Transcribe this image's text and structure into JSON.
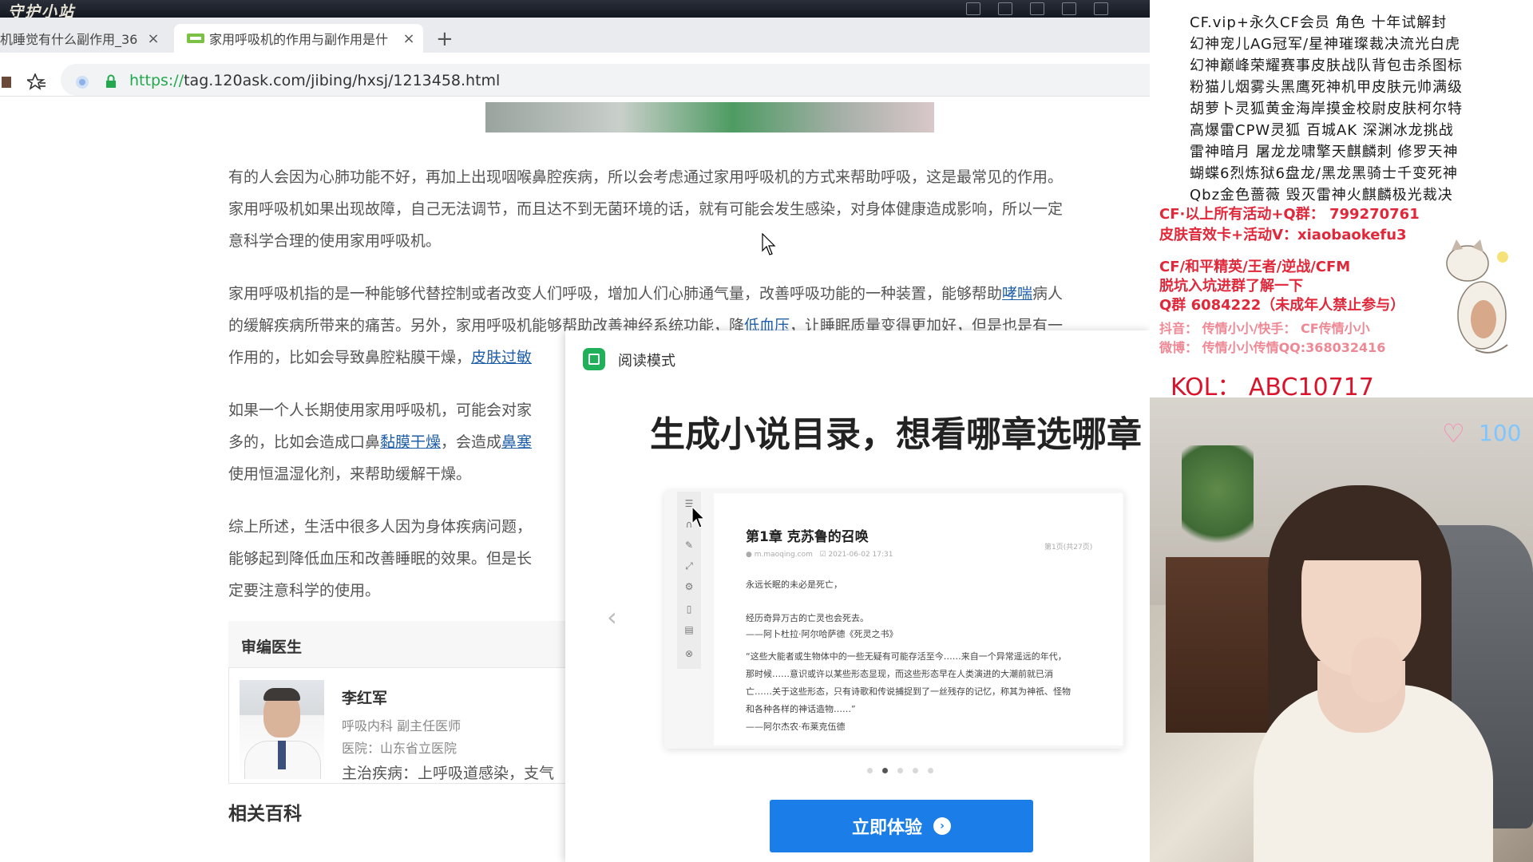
{
  "browser": {
    "game_bar_title": "守护小站",
    "tabs": [
      {
        "label": "机睡觉有什么副作用_36",
        "active": false
      },
      {
        "label": "家用呼吸机的作用与副作用是什",
        "active": true
      }
    ],
    "new_tab_label": "+",
    "close_label": "×",
    "url_scheme": "https://",
    "url_rest": "tag.120ask.com/jibing/hxsj/1213458.html"
  },
  "article": {
    "paragraphs": [
      {
        "lines": [
          [
            {
              "t": "有的人会因为心肺功能不好，再加上出现咽喉鼻腔疾病，所以会考虑通过家用呼吸机的方式来帮助呼吸，这是最常见的作用。"
            }
          ],
          [
            {
              "t": "家用呼吸机如果出现故障，自己无法调节，而且达不到无菌环境的话，就有可能会发生感染，对身体健康造成影响，所以一定"
            }
          ],
          [
            {
              "t": "意科学合理的使用家用呼吸机。"
            }
          ]
        ]
      },
      {
        "lines": [
          [
            {
              "t": "家用呼吸机指的是一种能够代替控制或者改变人们呼吸，增加人们心肺通气量，改善呼吸功能的一种装置，能够帮助"
            },
            {
              "t": "哮喘",
              "link": true
            },
            {
              "t": "病人"
            }
          ],
          [
            {
              "t": "的缓解疾病所带来的痛苦。另外，家用呼吸机能够帮助改善神经系统功能，降"
            },
            {
              "t": "低血压",
              "link": true
            },
            {
              "t": "，让睡眠质量变得更加好，但是也是有一"
            }
          ],
          [
            {
              "t": "作用的，比如会导致鼻腔粘膜干燥，"
            },
            {
              "t": "皮肤过敏",
              "link": true
            }
          ]
        ]
      },
      {
        "lines": [
          [
            {
              "t": "如果一个人长期使用家用呼吸机，可能会对家"
            }
          ],
          [
            {
              "t": "多的，比如会造成口鼻"
            },
            {
              "t": "黏膜干燥",
              "link": true
            },
            {
              "t": "，会造成"
            },
            {
              "t": "鼻塞",
              "link": true
            }
          ],
          [
            {
              "t": "使用恒温湿化剂，来帮助缓解干燥。"
            }
          ]
        ]
      },
      {
        "lines": [
          [
            {
              "t": "综上所述，生活中很多人因为身体疾病问题，"
            }
          ],
          [
            {
              "t": "能够起到降低血压和改善睡眠的效果。但是长"
            }
          ],
          [
            {
              "t": "定要注意科学的使用。"
            }
          ]
        ]
      }
    ],
    "audit": {
      "heading": "审编医生",
      "name": "李红军",
      "title": "呼吸内科  副主任医师",
      "hospital": "医院：山东省立医院",
      "specialty": "主治疾病：上呼吸道感染，支气"
    },
    "related_heading": "相关百科"
  },
  "reading_mode": {
    "label": "阅读模式",
    "headline": "生成小说目录，想看哪章选哪章",
    "prev_arrow": "‹",
    "preview": {
      "chapter_title": "第1章  克苏鲁的召唤",
      "meta_site": "m.maoqing.com",
      "meta_date": "2021-06-02 17:31",
      "page_indicator": "第1页(共27页)",
      "lines": [
        "永远长眠的未必是死亡，",
        "经历奇异万古的亡灵也会死去。",
        "——阿卜杜拉·阿尔哈萨德《死灵之书》",
        "“这些大能者或生物体中的一些无疑有可能存活至今……来自一个异常遥远的年代，",
        "那时候……意识或许以某些形态显现，而这些形态早在人类演进的大潮前就已消",
        "亡……关于这些形态，只有诗歌和传说捕捉到了一丝残存的记忆，称其为神祇、怪物",
        "和各种各样的神话造物……”",
        "——阿尔杰农·布莱克伍德"
      ]
    },
    "dots_count": 5,
    "active_dot": 1,
    "cta_label": "立即体验",
    "cta_arrow": "›"
  },
  "stream_overlay": {
    "service_lines": [
      "CF.vip+永久CF会员  角色  十年试解封",
      "幻神宠儿AG冠军/星神璀璨裁决流光白虎",
      "幻神巅峰荣耀赛事皮肤战队背包击杀图标",
      "粉猫儿烟雾头黑鹰死神机甲皮肤元帅满级",
      "胡萝卜灵狐黄金海岸摸金校尉皮肤柯尔特",
      "高爆雷CPW灵狐 百城AK 深渊冰龙挑战",
      "雷神暗月 屠龙龙啸擎天麒麟刺 修罗天神",
      "蝴蝶6烈炼狱6盘龙/黑龙黑骑士千变死神",
      "Qbz金色蔷薇  毁灭雷神火麒麟极光裁决"
    ],
    "red_lines": [
      "CF·以上所有活动+Q群： 799270761",
      "皮肤音效卡+活动V：xiaobaokefu3",
      "CF/和平精英/王者/逆战/CFM",
      "脱坑入坑进群了解一下",
      "Q群 6084222（未成年人禁止参与）"
    ],
    "muted_lines": [
      "抖音： 传情小小/快手： CF传情小小",
      "微博： 传情小小传情QQ:368032416"
    ],
    "kol": "KOL：  ABC10717",
    "viewer_count": "100"
  }
}
